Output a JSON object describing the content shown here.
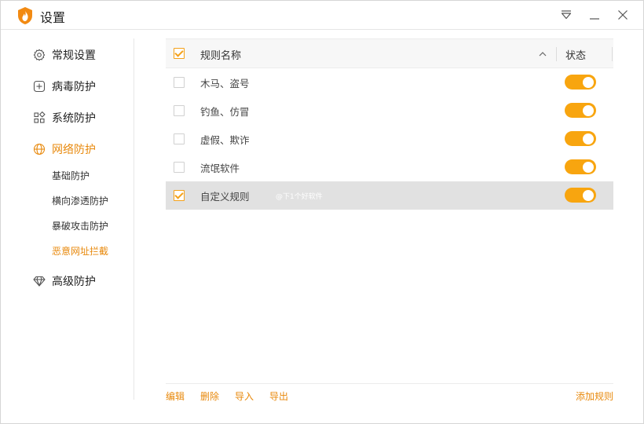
{
  "window": {
    "title": "设置",
    "icons": {
      "logo": "flame-shield-icon",
      "menu": "menu-triangle-icon",
      "minimize": "minimize-icon",
      "close": "close-icon"
    }
  },
  "sidebar": {
    "items": [
      {
        "label": "常规设置",
        "icon": "gear-icon"
      },
      {
        "label": "病毒防护",
        "icon": "plus-box-icon"
      },
      {
        "label": "系统防护",
        "icon": "grid-icon"
      },
      {
        "label": "网络防护",
        "icon": "globe-icon",
        "active": true
      },
      {
        "label": "高级防护",
        "icon": "diamond-icon"
      }
    ],
    "subitems": [
      {
        "label": "基础防护"
      },
      {
        "label": "横向渗透防护"
      },
      {
        "label": "暴破攻击防护"
      },
      {
        "label": "恶意网址拦截",
        "active": true
      }
    ]
  },
  "table": {
    "header": {
      "name": "规则名称",
      "status": "状态",
      "all_checked": true
    },
    "rows": [
      {
        "name": "木马、盗号",
        "checked": false,
        "enabled": true
      },
      {
        "name": "钓鱼、仿冒",
        "checked": false,
        "enabled": true
      },
      {
        "name": "虚假、欺诈",
        "checked": false,
        "enabled": true
      },
      {
        "name": "流氓软件",
        "checked": false,
        "enabled": true
      },
      {
        "name": "自定义规则",
        "checked": true,
        "enabled": true,
        "selected": true
      }
    ],
    "watermark": "@下1个好软件"
  },
  "footer": {
    "edit": "编辑",
    "delete": "删除",
    "import": "导入",
    "export": "导出",
    "add_rule": "添加规则"
  },
  "colors": {
    "accent": "#e8890c",
    "toggle_on": "#f8a50f",
    "selected_row": "#e1e1e1"
  }
}
